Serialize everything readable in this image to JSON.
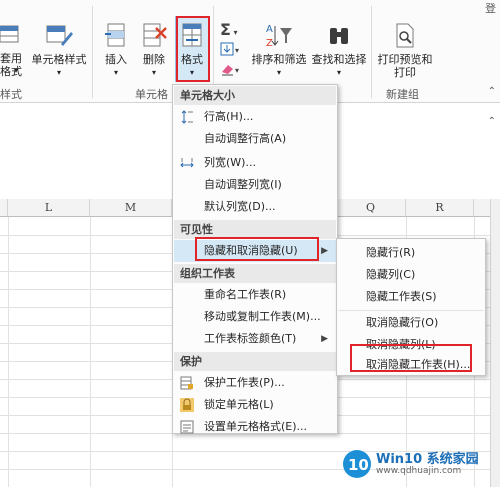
{
  "ribbon": {
    "top_right_text": "登",
    "buttons": {
      "use_format": "套用\n格式",
      "cell_styles": "单元格样式",
      "insert": "插入",
      "delete": "删除",
      "format": "格式",
      "sort_filter": "排序和筛选",
      "find_select": "查找和选择",
      "print_preview": "打印预览和\n打印"
    },
    "groups": {
      "styles": "样式",
      "cells": "单元格",
      "new_group": "新建组"
    }
  },
  "grid": {
    "columns": [
      "L",
      "M",
      "Q",
      "R"
    ]
  },
  "format_menu": {
    "sections": {
      "cell_size": "单元格大小",
      "visibility": "可见性",
      "organize": "组织工作表",
      "protect": "保护"
    },
    "items": {
      "row_height": "行高(H)...",
      "autofit_row": "自动调整行高(A)",
      "col_width": "列宽(W)...",
      "autofit_col": "自动调整列宽(I)",
      "default_width": "默认列宽(D)...",
      "hide_unhide": "隐藏和取消隐藏(U)",
      "rename": "重命名工作表(R)",
      "move_copy": "移动或复制工作表(M)...",
      "tab_color": "工作表标签颜色(T)",
      "protect_sheet": "保护工作表(P)...",
      "lock_cell": "锁定单元格(L)",
      "format_cells": "设置单元格格式(E)..."
    }
  },
  "submenu": {
    "items": {
      "hide_rows": "隐藏行(R)",
      "hide_cols": "隐藏列(C)",
      "hide_sheet": "隐藏工作表(S)",
      "unhide_rows": "取消隐藏行(O)",
      "unhide_cols": "取消隐藏列(L)",
      "unhide_sheet": "取消隐藏工作表(H)..."
    }
  },
  "watermark": {
    "brand": "Win10 系统家园",
    "url": "www.qdhuajin.com"
  },
  "colors": {
    "highlight_red": "#e0252a",
    "menu_hover": "#d5e8f6",
    "section_bg": "#e9e9e9"
  }
}
